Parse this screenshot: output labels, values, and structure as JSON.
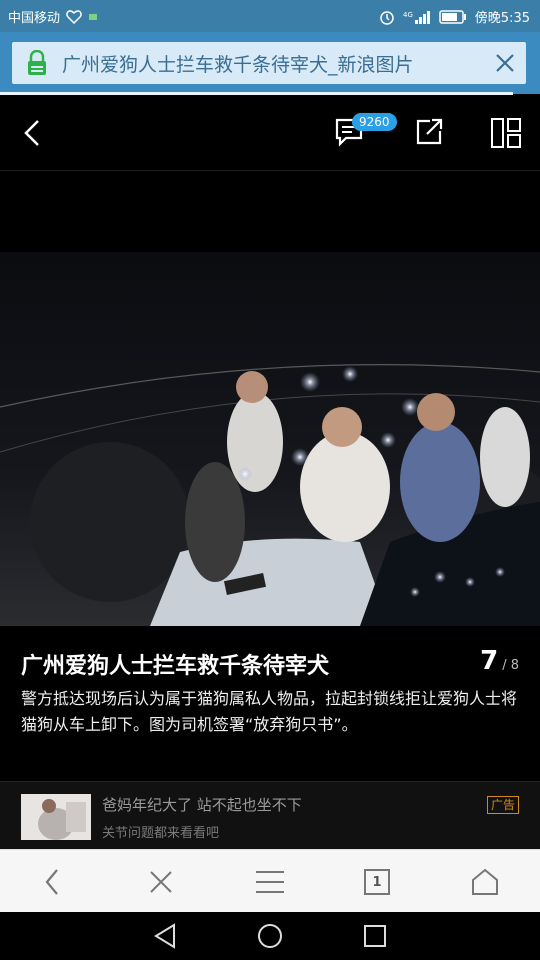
{
  "status": {
    "carrier": "中国移动",
    "time_text": "傍晚5:35",
    "icons": [
      "heart-icon",
      "alarm-icon",
      "signal-icon",
      "battery-icon"
    ]
  },
  "browser": {
    "url_title": "广州爱狗人士拦车救千条待宰犬_新浪图片",
    "accent": "#3b8ac0"
  },
  "toolbar": {
    "comment_count": "9260"
  },
  "article": {
    "title": "广州爱狗人士拦车救千条待宰犬",
    "current": "7",
    "total": "/ 8",
    "description": "警方抵达现场后认为属于猫狗属私人物品，拉起封锁线拒让爱狗人士将猫狗从车上卸下。图为司机签署“放弃狗只书”。"
  },
  "ad": {
    "title": "爸妈年纪大了 站不起也坐不下",
    "subtitle": "关节问题都来看看吧",
    "tag": "广告",
    "tag_color": "#d08a1f"
  },
  "bottom_nav": {
    "tab_count": "1"
  }
}
